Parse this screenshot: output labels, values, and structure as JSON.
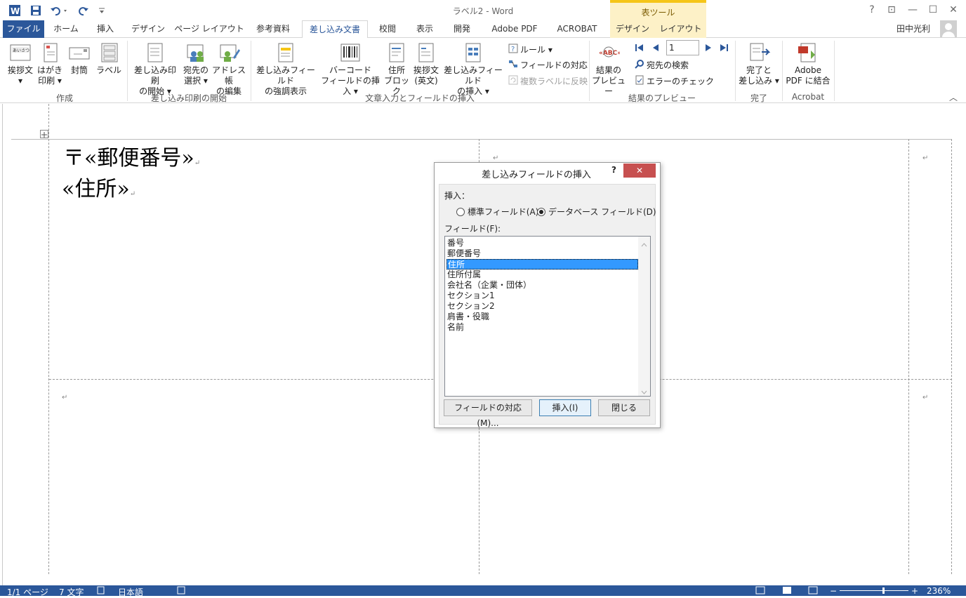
{
  "window": {
    "title": "ラベル2 - Word",
    "context_tools": "表ツール",
    "user": "田中光利",
    "help": "?",
    "ribbon_options": "⊡",
    "minimize": "—",
    "maximize": "☐",
    "close": "✕"
  },
  "tabs": {
    "file": "ファイル",
    "home": "ホーム",
    "insert": "挿入",
    "design": "デザイン",
    "page_layout": "ページ レイアウト",
    "references": "参考資料",
    "mailings": "差し込み文書",
    "review": "校閲",
    "view": "表示",
    "developer": "開発",
    "adobe_pdf": "Adobe  PDF",
    "acrobat": "ACROBAT",
    "table_design": "デザイン",
    "table_layout": "レイアウト"
  },
  "ribbon": {
    "create": {
      "greeting": [
        "挨拶文",
        "▾"
      ],
      "postcard": [
        "はがき",
        "印刷 ▾"
      ],
      "envelope": "封筒",
      "label": "ラベル",
      "group": "作成"
    },
    "start": {
      "start_merge": [
        "差し込み印刷",
        "の開始 ▾"
      ],
      "select_recipients": [
        "宛先の",
        "選択 ▾"
      ],
      "edit_list": [
        "アドレス帳",
        "の編集"
      ],
      "group": "差し込み印刷の開始"
    },
    "write": {
      "highlight": [
        "差し込みフィールド",
        "の強調表示"
      ],
      "barcode": [
        "バーコード",
        "フィールドの挿入 ▾"
      ],
      "address_block": [
        "住所",
        "ブロック"
      ],
      "greeting_line": [
        "挨拶文",
        "(英文)"
      ],
      "insert_field": [
        "差し込みフィールド",
        "の挿入 ▾"
      ],
      "rules": "ルール ▾",
      "match_fields": "フィールドの対応",
      "update_labels": "複数ラベルに反映",
      "group": "文章入力とフィールドの挿入"
    },
    "preview": {
      "preview_results": [
        "結果の",
        "プレビュー"
      ],
      "record": "1",
      "find_recipient": "宛先の検索",
      "check_errors": "エラーのチェック",
      "group": "結果のプレビュー"
    },
    "finish": {
      "finish_merge": [
        "完了と",
        "差し込み ▾"
      ],
      "group": "完了"
    },
    "acrobat": {
      "merge_pdf": [
        "Adobe",
        "PDF に結合"
      ],
      "group": "Acrobat"
    },
    "collapse": "︿"
  },
  "document": {
    "line1": "〒«郵便番号»",
    "line2": "«住所»",
    "para_mark": "↵"
  },
  "dialog": {
    "title": "差し込みフィールドの挿入",
    "help": "?",
    "close": "✕",
    "insert_label": "挿入：",
    "radio_standard": "標準フィールド(A)",
    "radio_database": "データベース フィールド(D)",
    "fields_label": "フィールド(F):",
    "fields": [
      "番号",
      "郵便番号",
      "住所",
      "住所付属",
      "会社名（企業・団体）",
      "セクション1",
      "セクション2",
      "肩書・役職",
      "名前"
    ],
    "selected_index": 2,
    "btn_match": "フィールドの対応(M)...",
    "btn_insert": "挿入(I)",
    "btn_close": "閉じる"
  },
  "status": {
    "page": "1/1 ページ",
    "words": "7 文字",
    "language": "日本語",
    "zoom": "236%"
  },
  "colors": {
    "accent": "#2b579a",
    "selection": "#3399ff",
    "context_tab": "#fdf1c7"
  }
}
